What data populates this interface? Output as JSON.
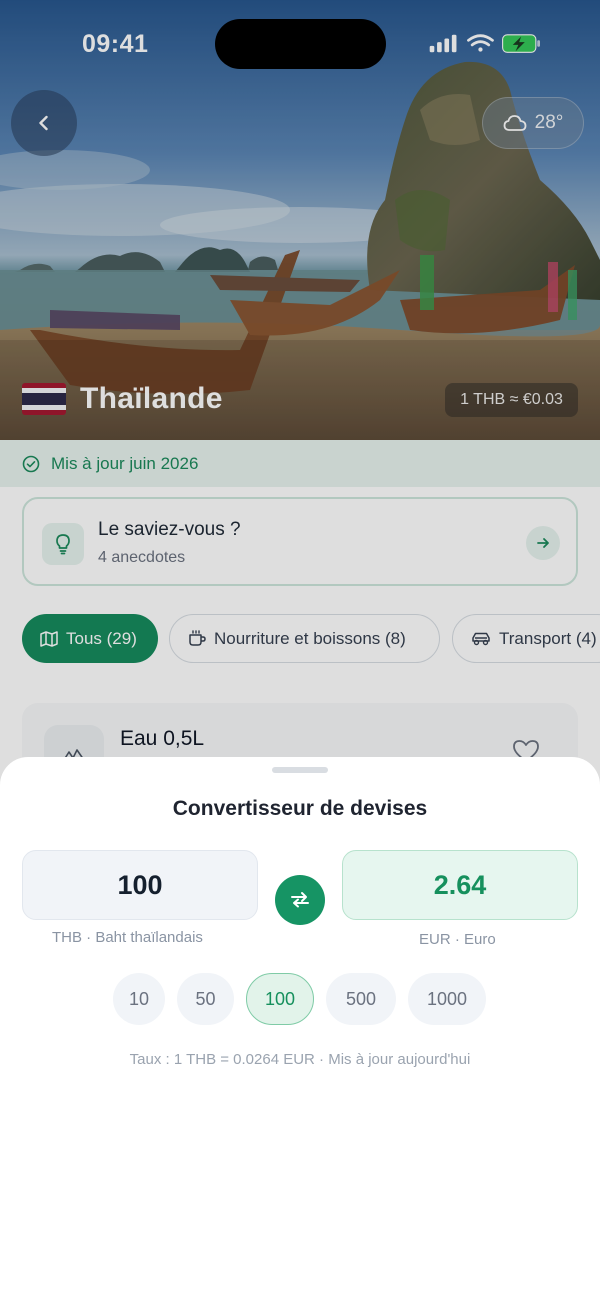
{
  "status_bar": {
    "time": "09:41"
  },
  "hero": {
    "weather": {
      "icon": "cloud-icon",
      "temperature": "28°"
    },
    "country": {
      "name": "Thaïlande",
      "flag_icon": "thailand-flag-icon"
    },
    "exchange_rate_badge": "1 THB ≈ €0.03"
  },
  "updated": {
    "icon": "check-circle-icon",
    "label": "Mis à jour juin 2026"
  },
  "tip_card": {
    "title": "Le saviez-vous ?",
    "subtitle": "4 anecdotes",
    "icon": "lightbulb-icon"
  },
  "filters": [
    {
      "label": "Tous (29)",
      "icon": "map-icon",
      "active": true
    },
    {
      "label": "Nourriture et boissons (8)",
      "icon": "coffee-cup-icon",
      "active": false
    },
    {
      "label": "Transport (4)",
      "icon": "car-icon",
      "active": false
    }
  ],
  "item_card": {
    "title": "Eau 0,5L",
    "icon": "mountain-icon",
    "favorite_icon": "heart-icon"
  },
  "converter": {
    "title": "Convertisseur de devises",
    "from": {
      "amount": "100",
      "label": "THB · Baht thaïlandais"
    },
    "to": {
      "amount": "2.64",
      "label": "EUR · Euro"
    },
    "quick_amounts": [
      {
        "label": "10",
        "active": false
      },
      {
        "label": "50",
        "active": false
      },
      {
        "label": "100",
        "active": true
      },
      {
        "label": "500",
        "active": false
      },
      {
        "label": "1000",
        "active": false
      }
    ],
    "rate_note": "Taux : 1 THB = 0.0264 EUR · Mis à jour aujourd'hui"
  },
  "colors": {
    "accent": "#169464",
    "accent_light": "#e6f6ef",
    "thai_red": "#a51931",
    "thai_blue": "#2d2a4a"
  }
}
